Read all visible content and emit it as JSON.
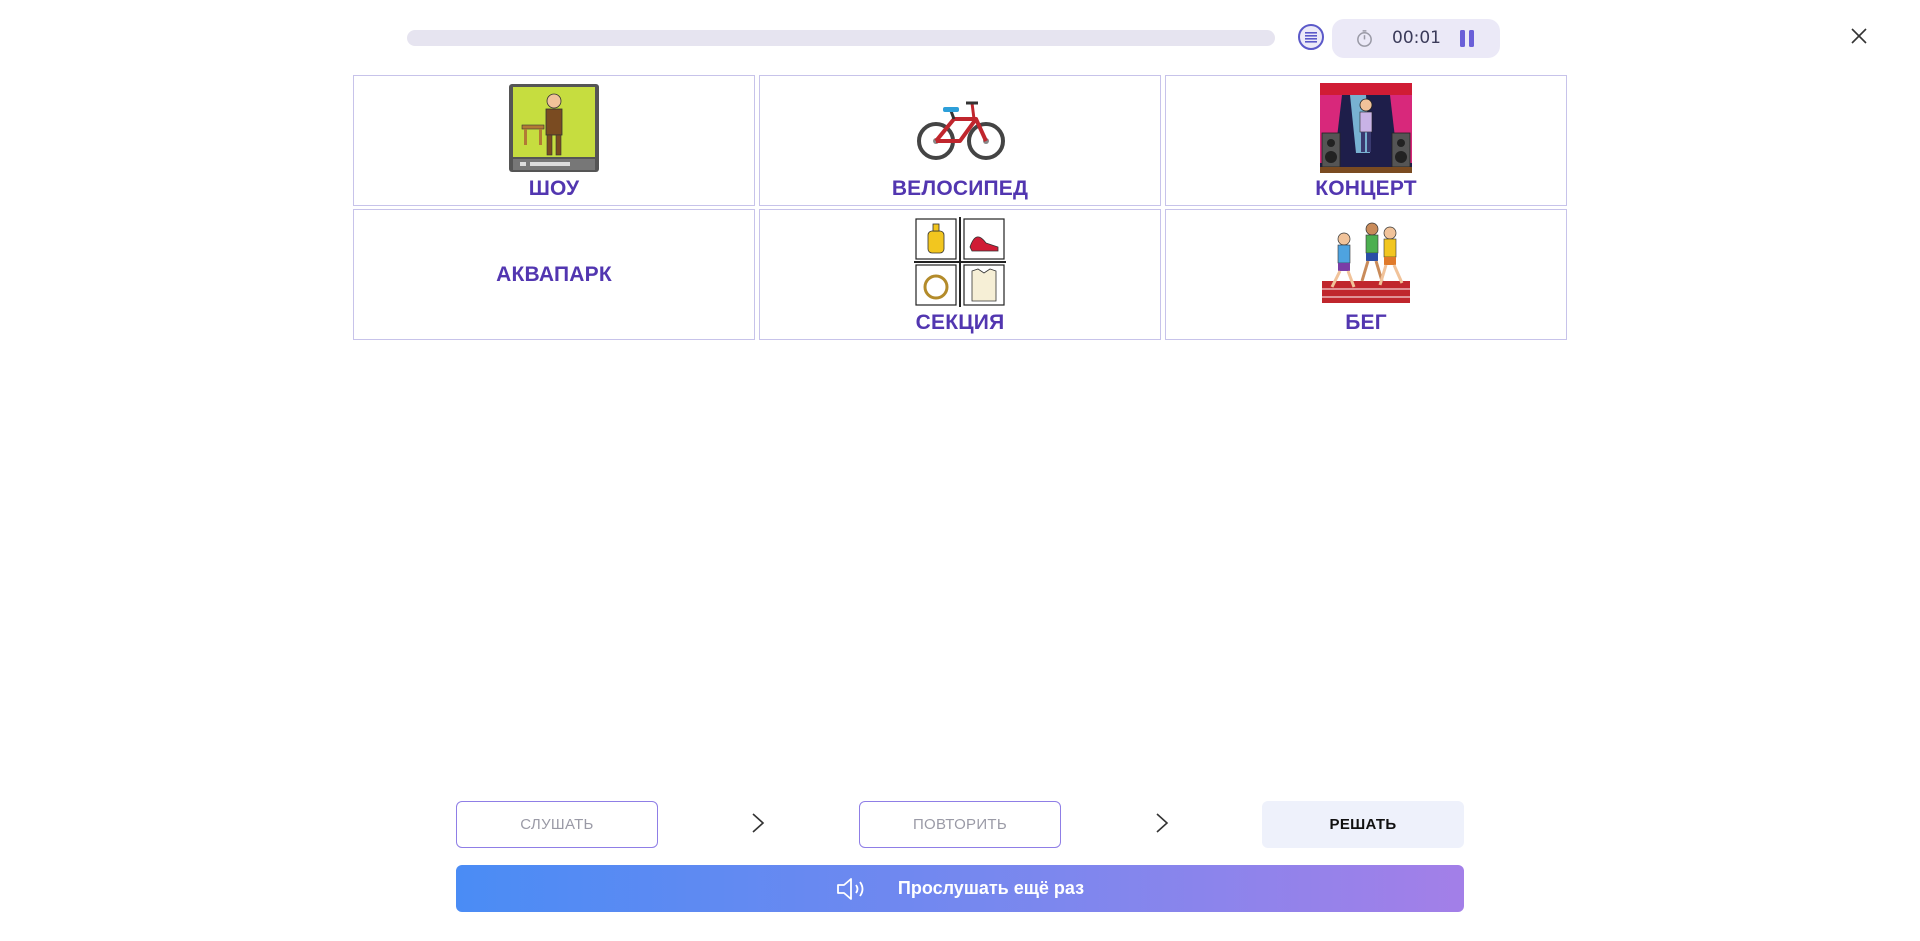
{
  "header": {
    "progress_fraction": 0.0,
    "timer": "00:01",
    "icons": {
      "menu": "list-icon",
      "clock": "stopwatch-icon",
      "pause": "pause-icon",
      "close": "close-icon"
    }
  },
  "cards": [
    {
      "label": "ШОУ",
      "icon": "tv-show-icon"
    },
    {
      "label": "ВЕЛОСИПЕД",
      "icon": "bicycle-icon"
    },
    {
      "label": "КОНЦЕРТ",
      "icon": "concert-stage-icon"
    },
    {
      "label": "АКВАПАРК",
      "icon": ""
    },
    {
      "label": "СЕКЦИЯ",
      "icon": "sections-icon"
    },
    {
      "label": "БЕГ",
      "icon": "running-icon"
    }
  ],
  "controls": {
    "listen_label": "СЛУШАТЬ",
    "repeat_label": "ПОВТОРИТЬ",
    "solve_label": "РЕШАТЬ",
    "replay_label": "Прослушать ещё раз",
    "replay_icon": "speaker-icon"
  },
  "colors": {
    "accent": "#5236b0",
    "card_border": "#c7c3ea",
    "gradient_start": "#4a8cf5",
    "gradient_end": "#a37fe8"
  }
}
